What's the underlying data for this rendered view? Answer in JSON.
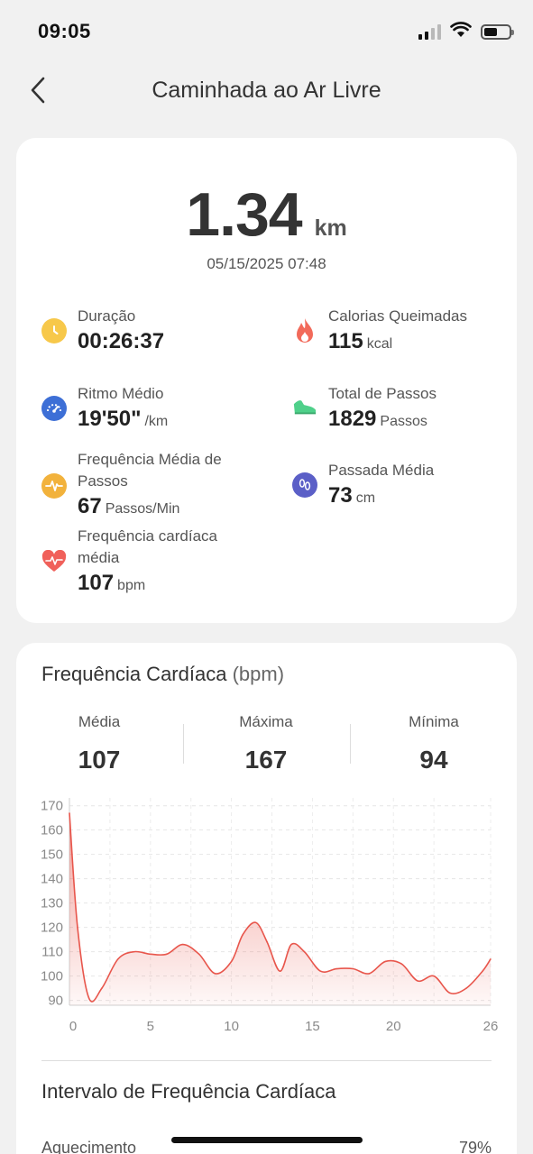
{
  "status_bar": {
    "time": "09:05"
  },
  "nav": {
    "title": "Caminhada ao Ar Livre"
  },
  "summary": {
    "distance_value": "1.34",
    "distance_unit": "km",
    "datetime": "05/15/2025 07:48",
    "metrics": {
      "duration": {
        "label": "Duração",
        "value": "00:26:37",
        "unit": "",
        "icon": "clock-icon",
        "color": "#f7c84a"
      },
      "calories": {
        "label": "Calorias Queimadas",
        "value": "115",
        "unit": "kcal",
        "icon": "flame-icon",
        "color": "#f26a5a"
      },
      "pace": {
        "label": "Ritmo Médio",
        "value": "19'50\"",
        "unit": "/km",
        "icon": "speedometer-icon",
        "color": "#3d6fd6"
      },
      "steps": {
        "label": "Total de Passos",
        "value": "1829",
        "unit": "Passos",
        "icon": "shoe-icon",
        "color": "#4fd08a"
      },
      "cadence": {
        "label": "Frequência Média de Passos",
        "value": "67",
        "unit": "Passos/Min",
        "icon": "cadence-icon",
        "color": "#f2b23c"
      },
      "stride": {
        "label": "Passada Média",
        "value": "73",
        "unit": "cm",
        "icon": "footprints-icon",
        "color": "#5b5fc7"
      },
      "heart_rate": {
        "label": "Frequência cardíaca média",
        "value": "107",
        "unit": "bpm",
        "icon": "heart-icon",
        "color": "#f0605a"
      }
    }
  },
  "heart_rate_card": {
    "title": "Frequência Cardíaca",
    "title_unit": "(bpm)",
    "stats": {
      "avg": {
        "label": "Média",
        "value": "107"
      },
      "max": {
        "label": "Máxima",
        "value": "167"
      },
      "min": {
        "label": "Mínima",
        "value": "94"
      }
    },
    "zone_title": "Intervalo de Frequência Cardíaca",
    "zones": [
      {
        "label": "Aquecimento",
        "percent": "79%"
      }
    ]
  },
  "chart_data": {
    "type": "area",
    "title": "",
    "xlabel": "",
    "ylabel": "",
    "xlim": [
      0,
      26
    ],
    "ylim": [
      88,
      171
    ],
    "x_ticks": [
      0,
      5,
      10,
      15,
      20,
      26
    ],
    "y_ticks": [
      90,
      100,
      110,
      120,
      130,
      140,
      150,
      160,
      170
    ],
    "grid": true,
    "color": "#e8564c",
    "series": [
      {
        "x": [
          0,
          0.5,
          1.2,
          2,
          3,
          4,
          5,
          6,
          7,
          8,
          9,
          10,
          10.7,
          11.5,
          12.2,
          13,
          13.7,
          14.5,
          15.5,
          16.5,
          17.5,
          18.5,
          19.5,
          20.5,
          21.5,
          22.5,
          23.5,
          24.5,
          25.5,
          26
        ],
        "y": [
          167,
          120,
          91,
          95,
          107,
          110,
          109,
          109,
          113,
          109,
          101,
          106,
          117,
          122,
          114,
          102,
          113,
          110,
          102,
          103,
          103,
          101,
          106,
          105,
          98,
          100,
          93,
          95,
          102,
          107
        ]
      }
    ]
  }
}
